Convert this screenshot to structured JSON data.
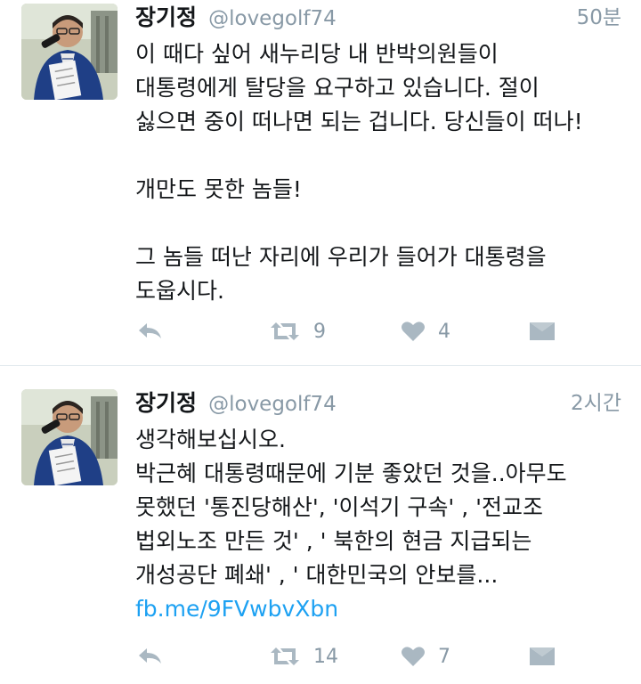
{
  "tweets": [
    {
      "author": "장기정",
      "handle": "@lovegolf74",
      "time": "50분",
      "text": "이 때다 싶어 새누리당 내 반박의원들이\n대통령에게 탈당을 요구하고 있습니다. 절이\n싫으면 중이 떠나면 되는 겁니다. 당신들이 떠나!\n\n개만도 못한 놈들!\n\n그 놈들 떠난 자리에 우리가 들어가 대통령을\n도웁시다.",
      "link": "",
      "retweets": "9",
      "likes": "4"
    },
    {
      "author": "장기정",
      "handle": "@lovegolf74",
      "time": "2시간",
      "text": "생각해보십시오.\n박근혜 대통령때문에 기분 좋았던 것을..아무도\n못했던 '통진당해산', '이석기 구속' , '전교조\n법외노조 만든 것' , ' 북한의 현금 지급되는\n개성공단 폐쇄' , ' 대한민국의 안보를...",
      "link": "fb.me/9FVwbvXbn",
      "retweets": "14",
      "likes": "7"
    }
  ],
  "icons": {
    "reply": "reply-icon",
    "retweet": "retweet-icon",
    "like": "heart-icon",
    "dm": "direct-message-icon"
  },
  "colors": {
    "text": "#14171a",
    "secondary": "#8899a6",
    "icon": "#aab8c2",
    "link": "#1da1f2",
    "divider": "#e1e8ed"
  }
}
